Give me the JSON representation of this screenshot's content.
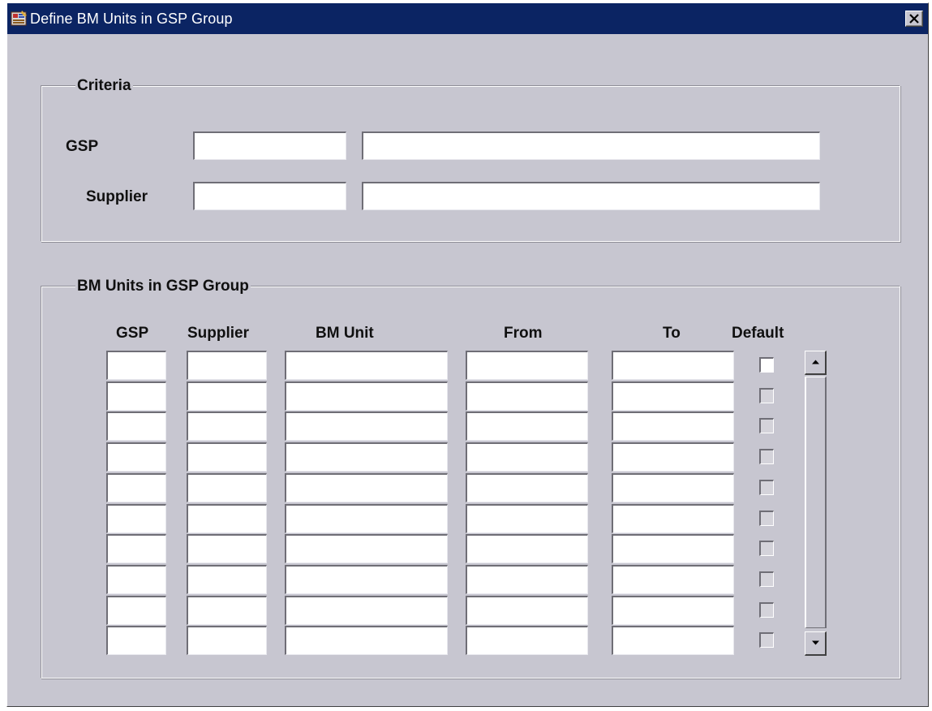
{
  "window": {
    "title": "Define BM Units in GSP Group"
  },
  "criteria": {
    "group_label": "Criteria",
    "gsp_label": "GSP",
    "gsp_code": "",
    "gsp_name": "",
    "supplier_label": "Supplier",
    "supplier_code": "",
    "supplier_name": ""
  },
  "bm_units": {
    "group_label": "BM Units in GSP Group",
    "columns": [
      "GSP",
      "Supplier",
      "BM Unit",
      "From",
      "To",
      "Default"
    ],
    "rows": [
      {
        "gsp": "",
        "supplier": "",
        "bm_unit": "",
        "from": "",
        "to": "",
        "default": false
      },
      {
        "gsp": "",
        "supplier": "",
        "bm_unit": "",
        "from": "",
        "to": "",
        "default": false
      },
      {
        "gsp": "",
        "supplier": "",
        "bm_unit": "",
        "from": "",
        "to": "",
        "default": false
      },
      {
        "gsp": "",
        "supplier": "",
        "bm_unit": "",
        "from": "",
        "to": "",
        "default": false
      },
      {
        "gsp": "",
        "supplier": "",
        "bm_unit": "",
        "from": "",
        "to": "",
        "default": false
      },
      {
        "gsp": "",
        "supplier": "",
        "bm_unit": "",
        "from": "",
        "to": "",
        "default": false
      },
      {
        "gsp": "",
        "supplier": "",
        "bm_unit": "",
        "from": "",
        "to": "",
        "default": false
      },
      {
        "gsp": "",
        "supplier": "",
        "bm_unit": "",
        "from": "",
        "to": "",
        "default": false
      },
      {
        "gsp": "",
        "supplier": "",
        "bm_unit": "",
        "from": "",
        "to": "",
        "default": false
      },
      {
        "gsp": "",
        "supplier": "",
        "bm_unit": "",
        "from": "",
        "to": "",
        "default": false
      }
    ]
  },
  "icons": {
    "app": "oracle-forms-app-icon",
    "close": "close-icon",
    "scroll_up": "scroll-up-arrow-icon",
    "scroll_down": "scroll-down-arrow-icon"
  },
  "colors": {
    "titlebar": "#0b2463",
    "window_bg": "#c7c6d0",
    "field_bg": "#ffffff"
  }
}
